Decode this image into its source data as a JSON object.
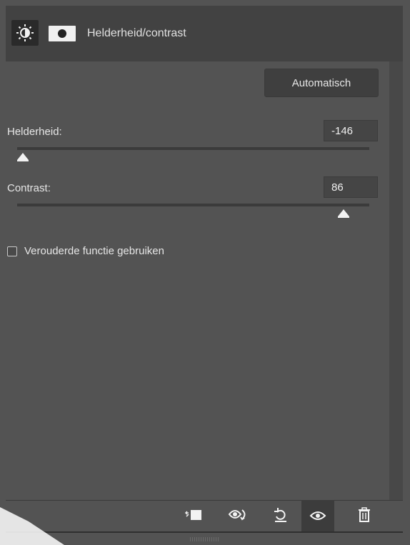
{
  "header": {
    "title": "Helderheid/contrast",
    "adjustment_icon": "brightness-contrast-icon",
    "mask_icon": "layer-mask-icon"
  },
  "controls": {
    "auto_button": "Automatisch",
    "brightness": {
      "label": "Helderheid:",
      "value": "-146"
    },
    "contrast": {
      "label": "Contrast:",
      "value": "86"
    },
    "legacy_label": "Verouderde functie gebruiken",
    "legacy_checked": false
  },
  "footer": {
    "icons": [
      "clip-to-layer-icon",
      "view-previous-state-icon",
      "reset-icon",
      "visibility-icon",
      "trash-icon"
    ]
  },
  "colors": {
    "panel": "#535353",
    "header": "#424242",
    "field": "#454545"
  }
}
